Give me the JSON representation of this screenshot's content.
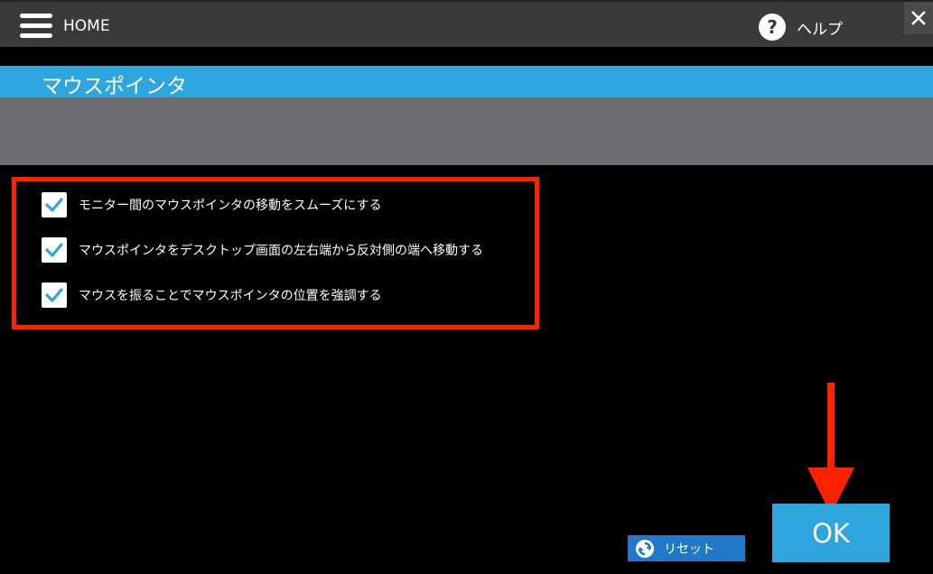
{
  "header": {
    "home_label": "HOME",
    "help_label": "ヘルプ",
    "help_icon_glyph": "?",
    "close_glyph": "✕"
  },
  "section": {
    "title": "マウスポインタ"
  },
  "options": [
    {
      "label": "モニター間のマウスポインタの移動をスムーズにする",
      "checked": true
    },
    {
      "label": "マウスポインタをデスクトップ画面の左右端から反対側の端へ移動する",
      "checked": true
    },
    {
      "label": "マウスを振ることでマウスポインタの位置を強調する",
      "checked": true
    }
  ],
  "footer": {
    "reset_label": "リセット",
    "ok_label": "OK"
  },
  "colors": {
    "accent": "#2ea5dc",
    "annotation": "#ff2200",
    "topbar": "#3a3a3a",
    "panel": "#6c6c70"
  }
}
